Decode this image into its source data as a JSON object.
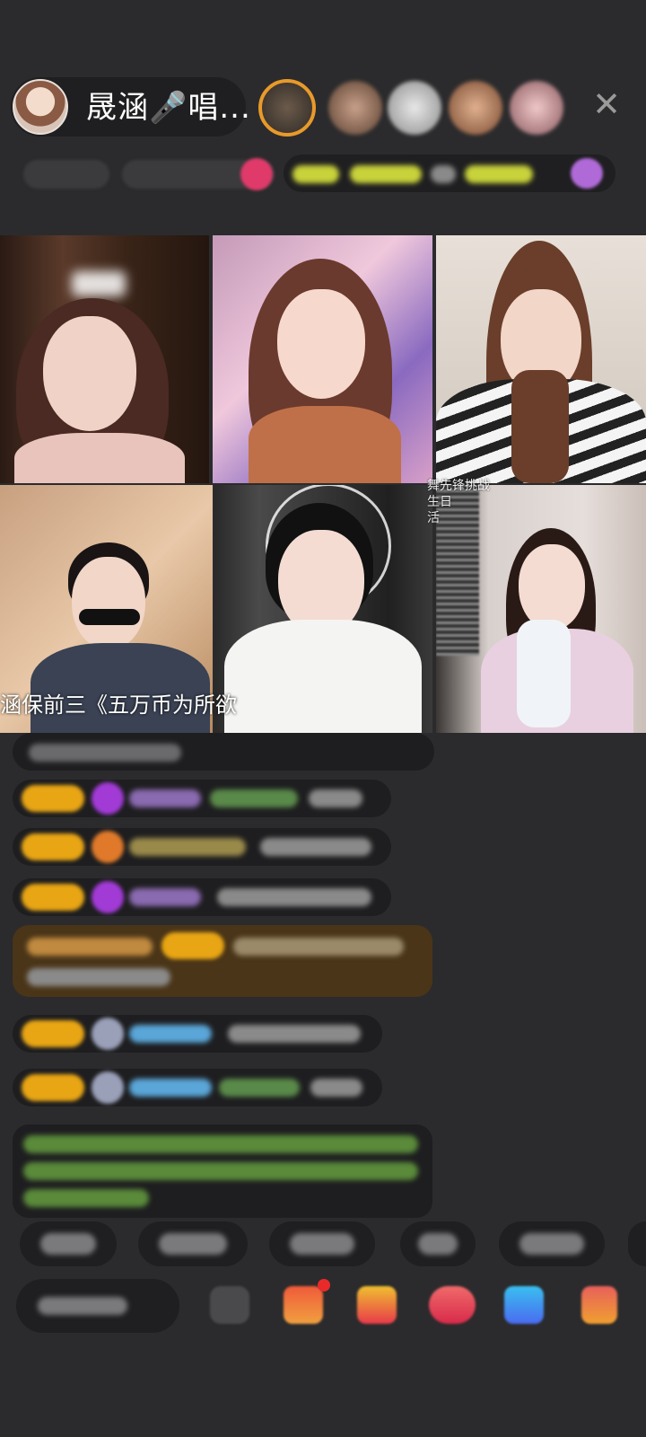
{
  "header": {
    "host_name": "晟涵🎤唱...",
    "close_glyph": "✕",
    "viewer_avatars": [
      "viewer-avatar-1",
      "viewer-avatar-2",
      "viewer-avatar-3",
      "viewer-avatar-4",
      "viewer-avatar-5"
    ]
  },
  "video_grid": {
    "marquee_text": "涵保前三《五万币为所欲",
    "corner_text": "舞先锋挑战\n生日\n活"
  },
  "chat": {
    "message_count": 9
  },
  "colors": {
    "background": "#2b2b2d",
    "pill": "#1f1f21",
    "level_badge": "#e8a514",
    "highlight_message": "#4a3518",
    "green_text": "#7cc45a",
    "blue_name": "#5aa6d8",
    "purple_gem": "#a23bd6"
  },
  "icons": [
    "close-icon",
    "gift-box-icon",
    "red-envelope-icon",
    "lucky-bag-icon",
    "game-icon",
    "share-icon",
    "more-icon"
  ]
}
